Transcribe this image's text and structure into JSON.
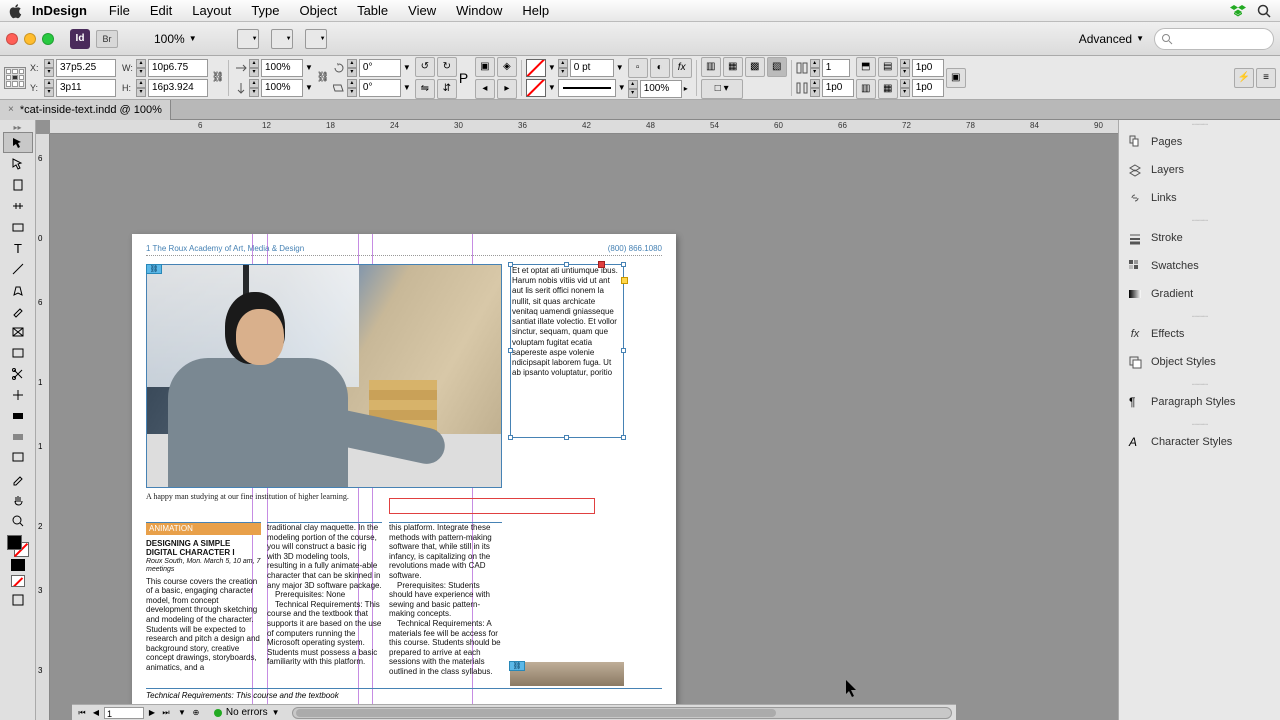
{
  "menubar": {
    "app": "InDesign",
    "items": [
      "File",
      "Edit",
      "Layout",
      "Type",
      "Object",
      "Table",
      "View",
      "Window",
      "Help"
    ]
  },
  "controlbar": {
    "zoom": "100%",
    "workspace": "Advanced"
  },
  "propsbar": {
    "x": "37p5.25",
    "y": "3p11",
    "w": "10p6.75",
    "h": "16p3.924",
    "scale_w": "100%",
    "scale_h": "100%",
    "rotate": "0°",
    "shear": "0°",
    "stroke_weight": "0 pt",
    "opacity": "100%",
    "cols": "1",
    "gutter": "1p0",
    "inset": "1p0"
  },
  "document": {
    "tab_title": "*cat-inside-text.indd @ 100%"
  },
  "ruler_h": {
    "marks": [
      {
        "pos": 0,
        "label": "6"
      },
      {
        "pos": 64,
        "label": "12"
      },
      {
        "pos": 128,
        "label": "18"
      },
      {
        "pos": 192,
        "label": "24"
      },
      {
        "pos": 256,
        "label": "30"
      },
      {
        "pos": 320,
        "label": "36"
      },
      {
        "pos": 384,
        "label": "42"
      },
      {
        "pos": 448,
        "label": "48"
      },
      {
        "pos": 512,
        "label": "54"
      },
      {
        "pos": 576,
        "label": "60"
      },
      {
        "pos": 640,
        "label": "66"
      },
      {
        "pos": 704,
        "label": "72"
      },
      {
        "pos": 768,
        "label": "78"
      },
      {
        "pos": 832,
        "label": "84"
      },
      {
        "pos": 896,
        "label": "90"
      }
    ]
  },
  "ruler_v": {
    "marks": [
      {
        "pos": 0,
        "label": "6"
      },
      {
        "pos": 64,
        "label": "0"
      },
      {
        "pos": 128,
        "label": "6"
      },
      {
        "pos": 192,
        "label": "1"
      },
      {
        "pos": 256,
        "label": "1"
      },
      {
        "pos": 320,
        "label": "2"
      },
      {
        "pos": 384,
        "label": "3"
      },
      {
        "pos": 448,
        "label": "3"
      }
    ]
  },
  "page": {
    "header_left": "1    The Roux Academy of Art, Media & Design",
    "header_right": "(800) 866.1080",
    "caption": "A happy man studying at our fine institution of higher learning.",
    "col1_hdr": "ANIMATION",
    "col1_title": "DESIGNING A SIMPLE DIGITAL CHARACTER I",
    "col1_meta": "Roux South, Mon. March 5, 10 am, 7 meetings",
    "col1_body": "This course covers the creation of a basic, engaging character model, from concept development through sketching and modeling of the character. Students will be expected to research and pitch a design and background story, creative concept drawings, storyboards, animatics, and a",
    "col2_body": "traditional clay maquette. In the modeling portion of the course, you will construct a basic rig with 3D modeling tools, resulting in a fully animate-able character that can be skinned in any major 3D software package.",
    "col2_pr": "Prerequisites: None",
    "col2_tr": "Technical Requirements: This course and the textbook that supports it are based on the use of computers running the Microsoft operating system. Students must possess a basic familiarity with this platform.",
    "col3_body": "this platform. Integrate these methods with pattern-making software that, while still in its infancy, is capitalizing on the revolutions made with CAD software.",
    "col3_pr": "Prerequisites: Students should have experience with sewing and basic pattern-making concepts.",
    "col3_tr": "Technical Requirements: A materials fee will be access for this course. Students should be prepared to arrive at each sessions with the materials outlined in the class syllabus.",
    "footer": "Technical Requirements: This course and the textbook",
    "frame_text": "Et et optat ati untiumque ibus.\nHarum nobis vitiis vid ut ant aut lis serit offici nonem la nullit, sit quas archicate venitaq uamendi gniasseque santiat illate volectio. Et vollor sinctur, sequam, quam que voluptam fugitat ecatia sapereste aspe volenie ndicipsapit laborem fuga. Ut ab ipsanto voluptatur, poritio"
  },
  "panels": {
    "group1": [
      "Pages",
      "Layers",
      "Links"
    ],
    "group2": [
      "Stroke",
      "Swatches",
      "Gradient"
    ],
    "group3": [
      "Effects",
      "Object Styles"
    ],
    "group4": [
      "Paragraph Styles"
    ],
    "group5": [
      "Character Styles"
    ]
  },
  "statusbar": {
    "page": "1",
    "preflight": "No errors"
  }
}
